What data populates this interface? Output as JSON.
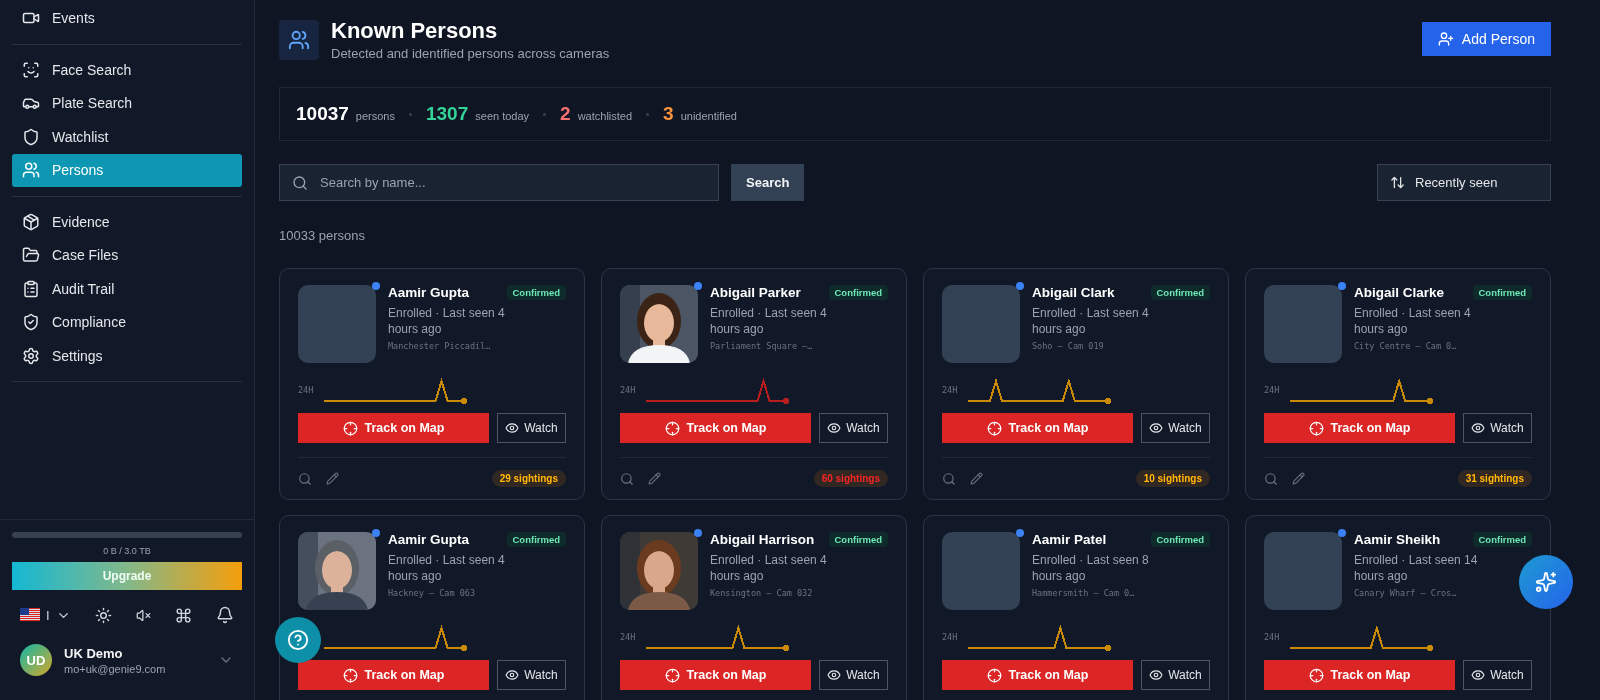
{
  "sidebar": {
    "groups": [
      [
        {
          "label": "Events",
          "selected": false
        }
      ],
      [
        {
          "label": "Face Search",
          "selected": false
        },
        {
          "label": "Plate Search",
          "selected": false
        },
        {
          "label": "Watchlist",
          "selected": false
        },
        {
          "label": "Persons",
          "selected": true
        }
      ],
      [
        {
          "label": "Evidence",
          "selected": false
        },
        {
          "label": "Case Files",
          "selected": false
        },
        {
          "label": "Audit Trail",
          "selected": false
        },
        {
          "label": "Compliance",
          "selected": false
        },
        {
          "label": "Settings",
          "selected": false
        }
      ]
    ],
    "storage": {
      "reading": "0 B / 3.0 TB"
    },
    "upgrade": "Upgrade",
    "language": "I",
    "user": {
      "initials": "UD",
      "name": "UK Demo",
      "email": "mo+uk@genie9.com"
    }
  },
  "header": {
    "title": "Known Persons",
    "subtitle": "Detected and identified persons across cameras",
    "action": "Add Person"
  },
  "stats": [
    {
      "value": "10037",
      "label": "persons",
      "color": "#ffffff"
    },
    {
      "value": "1307",
      "label": "seen today",
      "color": "#34d399"
    },
    {
      "value": "2",
      "label": "watchlisted",
      "color": "#f87171"
    },
    {
      "value": "3",
      "label": "unidentified",
      "color": "#fb923c"
    }
  ],
  "search": {
    "placeholder": "Search by name...",
    "button": "Search",
    "sort": "Recently seen"
  },
  "count": "10033 persons",
  "cards": [
    {
      "name": "Aamir Gupta",
      "status": "Confirmed",
      "meta": "Enrolled · Last seen 4 hours ago",
      "location": "Manchester Piccadil…",
      "avatar": {
        "kind": "placeholder"
      },
      "color": "#ca8a04",
      "range": "24H",
      "track": "Track on Map",
      "watch": "Watch",
      "sightings": "29 sightings"
    },
    {
      "name": "Abigail Parker",
      "status": "Confirmed",
      "meta": "Enrolled · Last seen 4 hours ago",
      "location": "Parliament Square –…",
      "color": "#b91c1c",
      "range": "24H",
      "track": "Track on Map",
      "watch": "Watch",
      "sightings": "60 sightings"
    },
    {
      "name": "Abigail Clark",
      "status": "Confirmed",
      "meta": "Enrolled · Last seen 4 hours ago",
      "location": "Soho — Cam 019",
      "avatar": {
        "kind": "placeholder"
      },
      "color": "#ca8a04",
      "range": "24H",
      "track": "Track on Map",
      "watch": "Watch",
      "sightings": "10 sightings"
    },
    {
      "name": "Abigail Clarke",
      "status": "Confirmed",
      "meta": "Enrolled · Last seen 4 hours ago",
      "location": "City Centre — Cam 0…",
      "avatar": {
        "kind": "placeholder"
      },
      "color": "#ca8a04",
      "range": "24H",
      "track": "Track on Map",
      "watch": "Watch",
      "sightings": "31 sightings"
    },
    {
      "name": "Aamir Gupta",
      "status": "Confirmed",
      "meta": "Enrolled · Last seen 4 hours ago",
      "location": "Hackney — Cam 063",
      "color": "#ca8a04",
      "track": "Track on Map",
      "watch": "Watch"
    },
    {
      "name": "Abigail Harrison",
      "status": "Confirmed",
      "meta": "Enrolled · Last seen 4 hours ago",
      "location": "Kensington — Cam 032",
      "color": "#ca8a04",
      "range": "24H",
      "track": "Track on Map",
      "watch": "Watch"
    },
    {
      "name": "Aamir Patel",
      "status": "Confirmed",
      "meta": "Enrolled · Last seen 8 hours ago",
      "location": "Hammersmith — Cam 0…",
      "avatar": {
        "kind": "placeholder"
      },
      "color": "#ca8a04",
      "range": "24H",
      "track": "Track on Map",
      "watch": "Watch"
    },
    {
      "name": "Aamir Sheikh",
      "status": "Confirmed",
      "meta": "Enrolled · Last seen 14 hours ago",
      "location": "Canary Wharf — Cros…",
      "avatar": {
        "kind": "placeholder"
      },
      "color": "#ca8a04",
      "range": "24H",
      "track": "Track on Map",
      "watch": "Watch"
    }
  ]
}
